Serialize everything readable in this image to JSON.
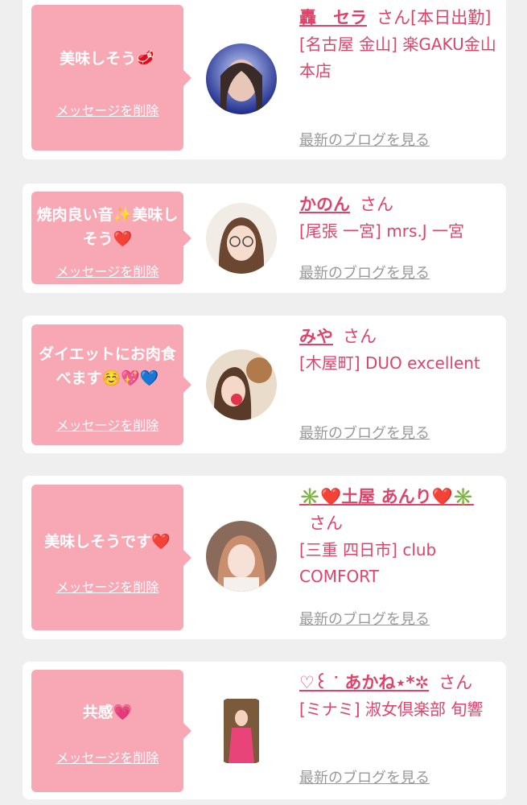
{
  "colors": {
    "bubble": "#f8a7b4",
    "accent": "#e0436a",
    "link_gray": "#999999",
    "background": "#efefef"
  },
  "cards": [
    {
      "message": "美味しそう🥩",
      "delete_label": "メッセージを削除",
      "name": "轟　セラ",
      "san": "さん",
      "status": "[本日出勤]",
      "shop": "[名古屋 金山] 楽GAKU金山本店",
      "blog_label": "最新のブログを見る"
    },
    {
      "message": "焼肉良い音✨美味しそう❤️",
      "delete_label": "メッセージを削除",
      "name": "かのん",
      "san": "さん",
      "status": "",
      "shop": "[尾張 一宮] mrs.J 一宮",
      "blog_label": "最新のブログを見る"
    },
    {
      "message": "ダイエットにお肉食べます☺️💖💙",
      "delete_label": "メッセージを削除",
      "name": "みや",
      "san": "さん",
      "status": "",
      "shop": "[木屋町] DUO excellent",
      "blog_label": "最新のブログを見る"
    },
    {
      "message": "美味しそうです❤️",
      "delete_label": "メッセージを削除",
      "name": "✳️❤️土屋 あんり❤️✳️",
      "san": "さん",
      "status": "",
      "shop": "[三重 四日市] club COMFORT",
      "blog_label": "最新のブログを見る"
    },
    {
      "message": "共感💗",
      "delete_label": "メッセージを削除",
      "name": "♡꒰ ᐝ あかね⋆*✲",
      "san": "さん",
      "status": "",
      "shop": "[ミナミ] 淑女倶楽部 旬響",
      "blog_label": "最新のブログを見る"
    }
  ]
}
